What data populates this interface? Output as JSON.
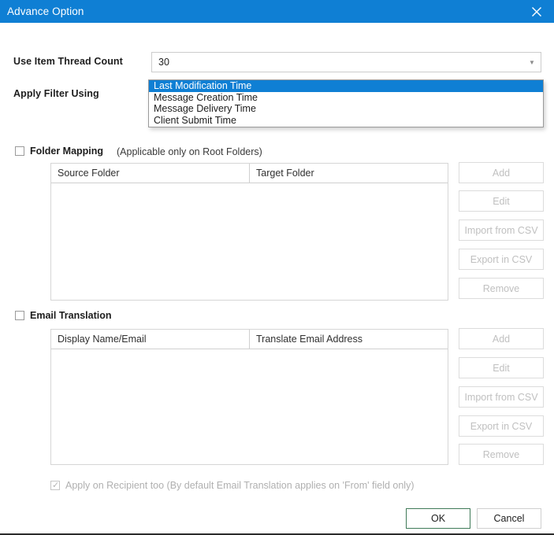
{
  "window": {
    "title": "Advance Option",
    "close_icon": "close-icon",
    "titlebar_color": "#0f7fd4"
  },
  "fields": {
    "thread_count": {
      "label": "Use Item Thread Count",
      "value": "30",
      "arrow_icon": "chevron-down-icon"
    },
    "apply_filter": {
      "label": "Apply Filter Using",
      "value": "Last Modification Time",
      "arrow_icon": "chevron-down-icon",
      "expanded": true,
      "accent_color": "#5d8f6a",
      "options": [
        {
          "label": "Last Modification Time",
          "selected": true
        },
        {
          "label": "Message Creation Time",
          "selected": false
        },
        {
          "label": "Message Delivery Time",
          "selected": false
        },
        {
          "label": "Client Submit Time",
          "selected": false
        }
      ]
    }
  },
  "folder_mapping": {
    "checkbox_label": "Folder Mapping",
    "checked": false,
    "hint": "(Applicable only on Root Folders)",
    "columns": [
      "Source Folder",
      "Target Folder"
    ],
    "rows": [],
    "buttons": [
      {
        "label": "Add",
        "enabled": false
      },
      {
        "label": "Edit",
        "enabled": false
      },
      {
        "label": "Import from CSV",
        "enabled": false
      },
      {
        "label": "Export in CSV",
        "enabled": false
      },
      {
        "label": "Remove",
        "enabled": false
      }
    ]
  },
  "email_translation": {
    "checkbox_label": "Email Translation",
    "checked": false,
    "columns": [
      "Display Name/Email",
      "Translate Email Address"
    ],
    "rows": [],
    "buttons": [
      {
        "label": "Add",
        "enabled": false
      },
      {
        "label": "Edit",
        "enabled": false
      },
      {
        "label": "Import from CSV",
        "enabled": false
      },
      {
        "label": "Export in CSV",
        "enabled": false
      },
      {
        "label": "Remove",
        "enabled": false
      }
    ],
    "recipient_option": {
      "label": "Apply on Recipient too (By default Email Translation applies on 'From' field only)",
      "checked": true,
      "enabled": false,
      "check_icon": "checkmark-icon"
    }
  },
  "footer": {
    "ok_label": "OK",
    "cancel_label": "Cancel",
    "ok_accent": "#3f7a58"
  }
}
